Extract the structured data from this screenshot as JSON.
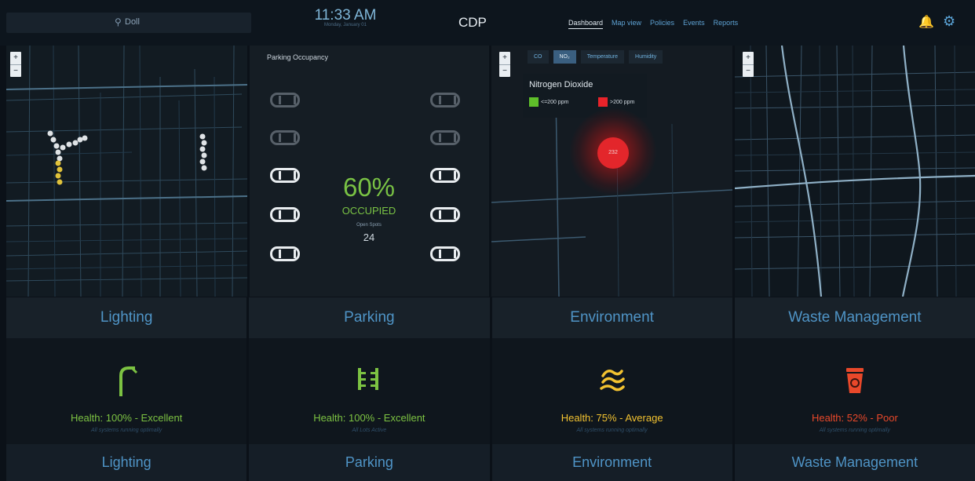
{
  "header": {
    "location": "Doll",
    "time": "11:33 AM",
    "date": "Monday, January 01",
    "brand": "CDP",
    "nav": [
      "Dashboard",
      "Map view",
      "Policies",
      "Events",
      "Reports"
    ],
    "active_nav": "Dashboard",
    "icons": [
      "location-pin-icon",
      "bell-icon",
      "gear-icon"
    ]
  },
  "parking_panel": {
    "title": "Parking Occupancy",
    "percent": "60%",
    "occupied_label": "OCCUPIED",
    "open_label": "Open Spots",
    "open_count": "24"
  },
  "environment_panel": {
    "tabs": [
      "CO",
      "NO₂",
      "Temperature",
      "Humidity"
    ],
    "active_tab": "NO₂",
    "legend_title": "Nitrogen Dioxide",
    "legend": [
      {
        "label": "<=200 ppm",
        "color": "#5fbf2a"
      },
      {
        "label": ">200 ppm",
        "color": "#e8232a"
      }
    ],
    "hotspot_value": "232"
  },
  "modules": [
    {
      "title": "Lighting",
      "health": "Health: 100% - Excellent",
      "sub": "All systems running optimally",
      "color": "#7cc242",
      "icon": "street-light-icon"
    },
    {
      "title": "Parking",
      "health": "Health: 100% - Excellent",
      "sub": "All Lots Active",
      "color": "#7cc242",
      "icon": "parking-lot-icon"
    },
    {
      "title": "Environment",
      "health": "Health: 75% - Average",
      "sub": "All systems running optimally",
      "color": "#f2c230",
      "icon": "air-quality-icon"
    },
    {
      "title": "Waste Management",
      "health": "Health: 52% - Poor",
      "sub": "All systems running optimally",
      "color": "#e8482a",
      "icon": "waste-bin-icon"
    }
  ],
  "zoom": {
    "in": "+",
    "out": "−"
  }
}
